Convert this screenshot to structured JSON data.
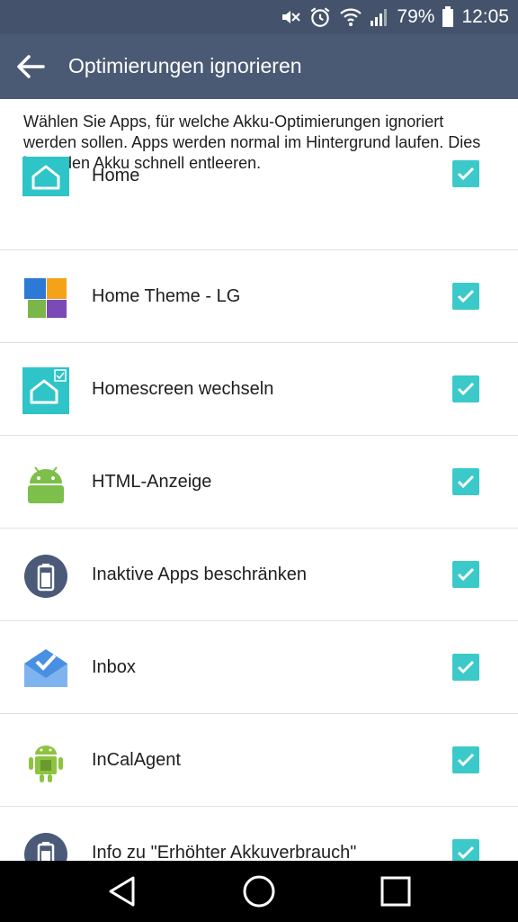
{
  "status": {
    "battery_percent": "79%",
    "time": "12:05"
  },
  "appbar": {
    "title": "Optimierungen ignorieren"
  },
  "description": "Wählen Sie Apps, für welche Akku-Optimierungen ignoriert werden sollen. Apps werden normal im Hintergrund laufen. Dies kann den Akku schnell entleeren.",
  "apps": [
    {
      "label": "Home",
      "icon": "home-icon",
      "checked": true
    },
    {
      "label": "Home Theme - LG",
      "icon": "home-theme-icon",
      "checked": true
    },
    {
      "label": "Homescreen wechseln",
      "icon": "homescreen-switch-icon",
      "checked": true
    },
    {
      "label": "HTML-Anzeige",
      "icon": "android-icon",
      "checked": true
    },
    {
      "label": "Inaktive Apps beschränken",
      "icon": "battery-icon",
      "checked": true
    },
    {
      "label": "Inbox",
      "icon": "inbox-icon",
      "checked": true
    },
    {
      "label": "InCalAgent",
      "icon": "android-robot-icon",
      "checked": true
    },
    {
      "label": "Info zu \"Erhöhter Akkuverbrauch\"",
      "icon": "battery-icon",
      "checked": true
    }
  ],
  "colors": {
    "appbar": "#4b5a74",
    "statusbar": "#44536b",
    "checkbox": "#3cc9c9"
  }
}
